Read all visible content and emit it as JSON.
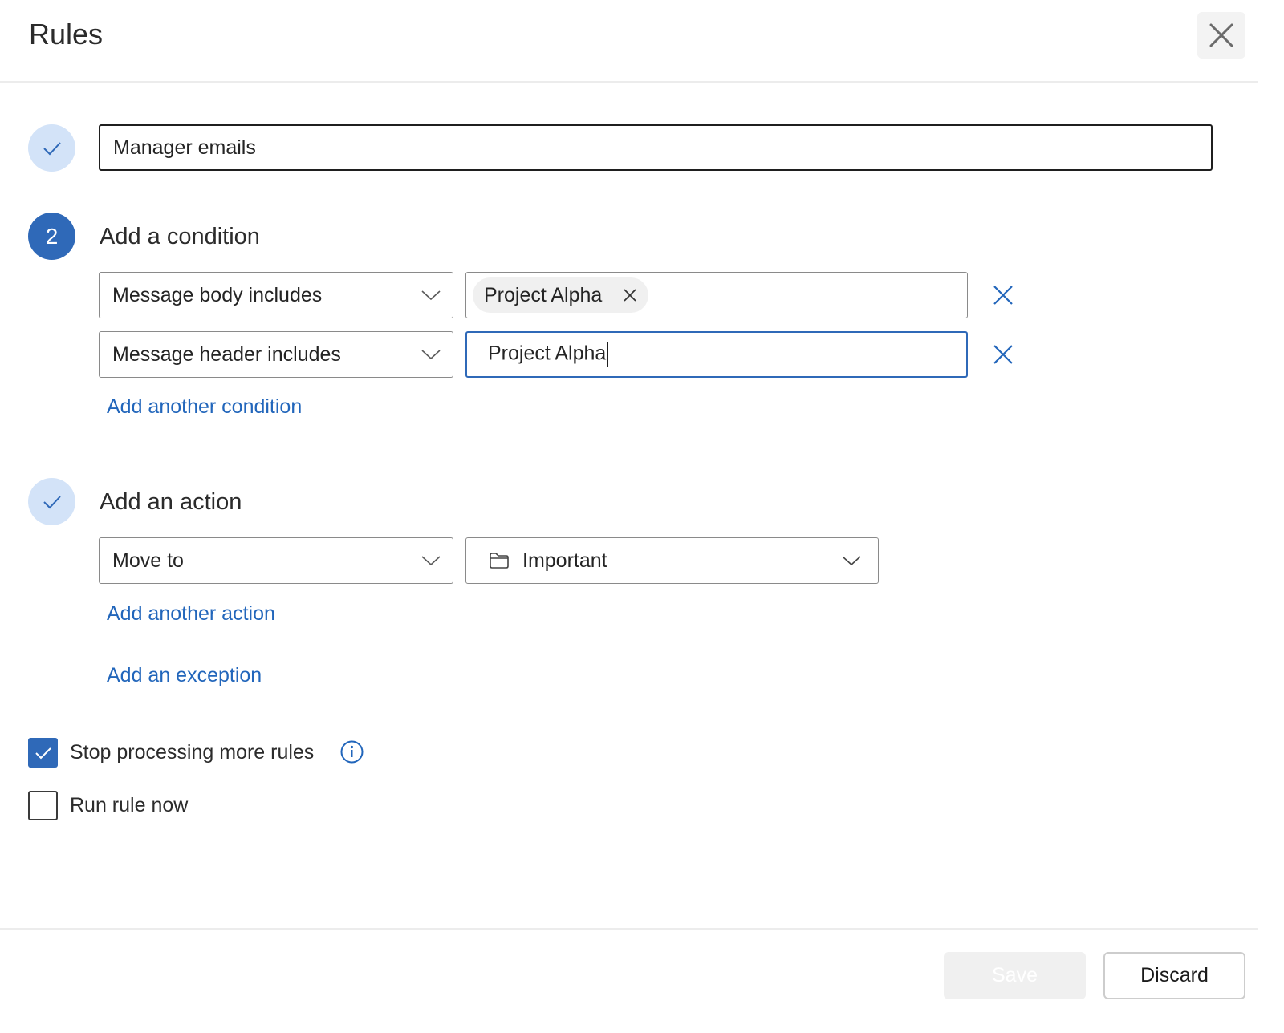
{
  "dialog": {
    "title": "Rules",
    "close_icon": "close-icon"
  },
  "rule_name": {
    "step_icon": "checkmark-icon",
    "value": "Manager emails"
  },
  "condition_section": {
    "step_number": "2",
    "title": "Add a condition",
    "conditions": [
      {
        "type": "Message body includes",
        "chips": [
          "Project Alpha"
        ],
        "input_value": "",
        "remove_icon": "close-icon"
      },
      {
        "type": "Message header includes",
        "chips": [],
        "input_value": "Project Alpha",
        "remove_icon": "close-icon"
      }
    ],
    "add_link": "Add another condition"
  },
  "action_section": {
    "step_icon": "checkmark-icon",
    "title": "Add an action",
    "action_type": "Move to",
    "folder_icon": "folder-icon",
    "folder_value": "Important",
    "add_link": "Add another action",
    "exception_link": "Add an exception"
  },
  "options": {
    "stop_processing": {
      "label": "Stop processing more rules",
      "checked": true,
      "info_icon": "info-icon"
    },
    "run_now": {
      "label": "Run rule now",
      "checked": false
    }
  },
  "footer": {
    "save_label": "Save",
    "save_enabled": false,
    "discard_label": "Discard"
  },
  "colors": {
    "accent": "#2f69b8",
    "link": "#2266bb",
    "step_done_bg": "#d3e3f8"
  }
}
